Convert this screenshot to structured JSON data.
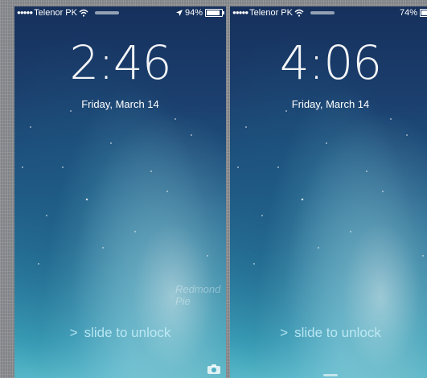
{
  "left_screen": {
    "carrier": "Telenor PK",
    "battery": "94%",
    "battery_level": 0.94,
    "time": "2:46",
    "date": "Friday, March 14",
    "slide_text": "slide to unlock",
    "watermark": "Redmond Pie"
  },
  "right_screen": {
    "carrier": "Telenor PK",
    "battery": "74%",
    "battery_level": 0.74,
    "time": "4:06",
    "date": "Friday, March 14",
    "slide_text": "slide to unlock"
  },
  "icons": {
    "signal": "signal-dots-icon",
    "wifi": "wifi-icon",
    "battery": "battery-icon",
    "location": "location-arrow-icon",
    "camera": "camera-icon",
    "chevron": "chevron-right-icon"
  }
}
